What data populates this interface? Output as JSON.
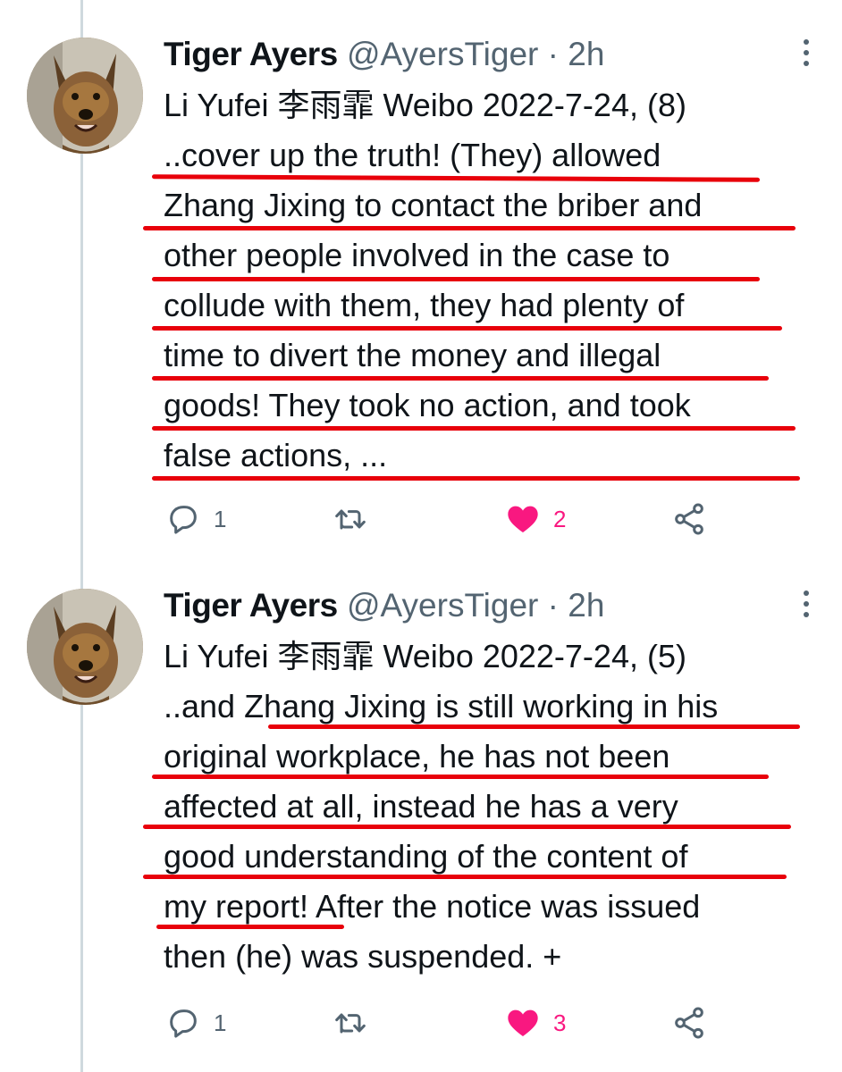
{
  "tweets": [
    {
      "author": {
        "name": "Tiger Ayers",
        "handle": "@AyersTiger",
        "separator": "·",
        "time": "2h"
      },
      "lines": [
        "Li Yufei 李雨霏 Weibo 2022-7-24, (8)",
        "..cover up the truth! (They) allowed",
        "Zhang Jixing to contact the briber and",
        "other people involved in the case to",
        "collude with them, they had plenty of",
        "time to divert the money and illegal",
        "goods! They took no action, and took",
        "false actions, ..."
      ],
      "actions": {
        "reply_count": "1",
        "retweet_count": "",
        "like_count": "2",
        "liked": true
      }
    },
    {
      "author": {
        "name": "Tiger Ayers",
        "handle": "@AyersTiger",
        "separator": "·",
        "time": "2h"
      },
      "lines": [
        "Li Yufei 李雨霏 Weibo 2022-7-24, (5)",
        "..and Zhang Jixing is still working in his",
        "original workplace, he has not been",
        "affected at all, instead he has a very",
        "good understanding of the content of",
        "my report! After the notice was issued",
        "then (he) was suspended. +"
      ],
      "actions": {
        "reply_count": "1",
        "retweet_count": "",
        "like_count": "3",
        "liked": true
      }
    }
  ],
  "icons": {
    "reply": "reply-icon",
    "retweet": "retweet-icon",
    "like": "heart-filled-icon",
    "share": "share-icon",
    "more": "more-options-icon"
  },
  "colors": {
    "text": "#0f1419",
    "secondary": "#536471",
    "like": "#f91880",
    "annotation": "#e8000a"
  }
}
